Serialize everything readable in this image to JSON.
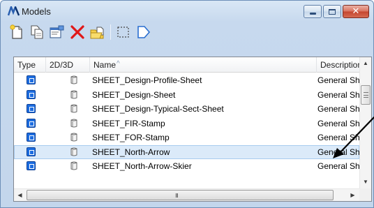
{
  "window": {
    "title": "Models",
    "app_icon": "microstation-logo-icon",
    "controls": [
      "minimize-icon",
      "maximize-icon",
      "close-icon"
    ]
  },
  "toolbar": [
    "create-model-icon",
    "copy-model-icon",
    "edit-model-properties-icon",
    "delete-model-icon",
    "import-model-icon",
    "select-area-icon",
    "export-arrow-icon"
  ],
  "table": {
    "columns": [
      "Type",
      "2D/3D",
      "Name",
      "Description"
    ],
    "sort_indicator": "^",
    "sorted_column": "Name",
    "rows": [
      {
        "name": "SHEET_Design-Profile-Sheet",
        "description": "General Shee",
        "selected": false
      },
      {
        "name": "SHEET_Design-Sheet",
        "description": "General Shee",
        "selected": false
      },
      {
        "name": "SHEET_Design-Typical-Sect-Sheet",
        "description": "General Shee",
        "selected": false
      },
      {
        "name": "SHEET_FIR-Stamp",
        "description": "General Shee",
        "selected": false
      },
      {
        "name": "SHEET_FOR-Stamp",
        "description": "General Shee",
        "selected": false
      },
      {
        "name": "SHEET_North-Arrow",
        "description": "General Shee",
        "selected": true
      },
      {
        "name": "SHEET_North-Arrow-Skier",
        "description": "General Shee",
        "selected": false
      }
    ]
  },
  "scrollbar": {
    "horizontal_grip": "III"
  },
  "colors": {
    "selection": "#dbeaf9",
    "type_icon": "#1d6de0",
    "close_button": "#c4452f"
  }
}
